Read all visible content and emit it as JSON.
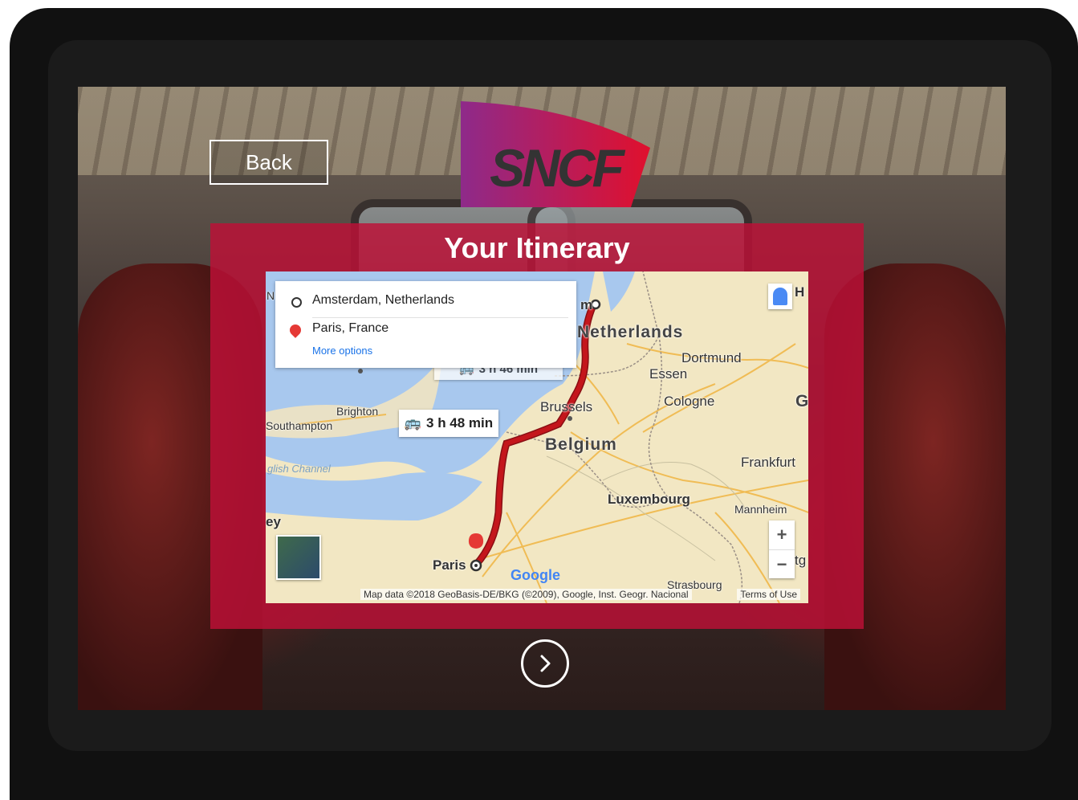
{
  "header": {
    "back_label": "Back",
    "logo_text": "SNCF"
  },
  "panel": {
    "title": "Your Itinerary"
  },
  "map": {
    "origin": "Amsterdam, Netherlands",
    "destination": "Paris, France",
    "more_options": "More options",
    "travel_time": "3 h 48 min",
    "alt_time_partial": "3 h 46 min",
    "labels": {
      "netherlands": "Netherlands",
      "belgium": "Belgium",
      "luxembourg": "Luxembourg",
      "dortmund": "Dortmund",
      "essen": "Essen",
      "cologne": "Cologne",
      "brussels": "Brussels",
      "frankfurt": "Frankfurt",
      "mannheim": "Mannheim",
      "brighton": "Brighton",
      "southampton": "Southampton",
      "english_channel": "glish Channel",
      "paris": "Paris",
      "strasbourg": "Strasbourg",
      "amsterdam_partial": "m",
      "edge_h": "H",
      "edge_g": "G",
      "edge_tg": "tg",
      "edge_n": "N",
      "edge_ey": "ey"
    },
    "google": "Google",
    "attribution": "Map data ©2018 GeoBasis-DE/BKG (©2009), Google, Inst. Geogr. Nacional",
    "terms": "Terms of Use",
    "zoom_in": "+",
    "zoom_out": "−",
    "route_color": "#c4161c"
  },
  "colors": {
    "panel": "#be1037",
    "logo_gradient_start": "#8e2a8a",
    "logo_gradient_end": "#e0102d"
  }
}
